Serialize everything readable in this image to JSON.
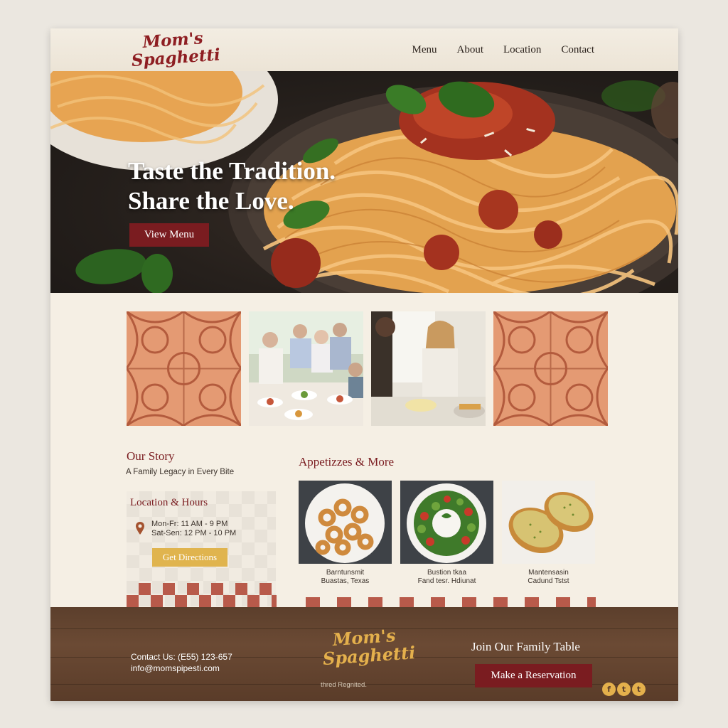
{
  "brand": {
    "line1": "Mom's",
    "line2": "Spaghetti"
  },
  "nav": [
    "Menu",
    "About",
    "Location",
    "Contact"
  ],
  "hero": {
    "title_line1": "Taste the Tradition.",
    "title_line2": "Share the Love.",
    "button": "View Menu"
  },
  "story": {
    "title": "Our Story",
    "subtitle": "A Family Legacy in Every Bite"
  },
  "location": {
    "title": "Location & Hours",
    "hours1": "Mon-Fr: 11 AM - 9 PM",
    "hours2": "Sat-Sen: 12 PM - 10 PM",
    "button": "Get Directions"
  },
  "appetizers": {
    "title": "Appetizzes & More",
    "items": [
      {
        "line1": "Barntunsmit",
        "line2": "Buastas, Texas"
      },
      {
        "line1": "Bustion tkaa",
        "line2": "Fand tesr. Hdiunat"
      },
      {
        "line1": "Mantensasin",
        "line2": "Cadund Tstst"
      }
    ]
  },
  "footer": {
    "contact_phone": "Contact Us: (E55) 123-657",
    "contact_email": "info@momspipesti.com",
    "small": "thred Regnited.",
    "join": "Join Our Family Table",
    "button": "Make a Reservation",
    "social": [
      "facebook-icon",
      "twitter-icon",
      "twitter-icon"
    ]
  },
  "colors": {
    "accent": "#7a1c20",
    "gold": "#e0b44e",
    "wood": "#5c3f2c"
  }
}
